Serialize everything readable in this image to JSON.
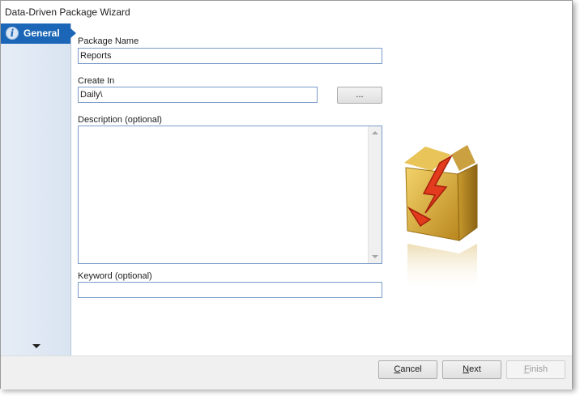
{
  "window": {
    "title": "Data-Driven Package Wizard"
  },
  "sidebar": {
    "items": [
      {
        "label": "General",
        "icon": "info-icon",
        "selected": true
      }
    ],
    "scroll_icon": "chevron-down-icon"
  },
  "form": {
    "package_name": {
      "label": "Package Name",
      "value": "Reports"
    },
    "create_in": {
      "label": "Create In",
      "value": "Daily\\",
      "browse_label": "..."
    },
    "description": {
      "label": "Description (optional)",
      "value": ""
    },
    "keyword": {
      "label": "Keyword (optional)",
      "value": ""
    }
  },
  "illustration": {
    "icon": "package-box-icon"
  },
  "footer": {
    "cancel": {
      "accel": "C",
      "rest": "ancel"
    },
    "next": {
      "accel": "N",
      "rest": "ext"
    },
    "finish": {
      "accel": "F",
      "rest": "inish",
      "enabled": false
    }
  },
  "colors": {
    "accent": "#1b66b6",
    "sidebar_bg": "#dde6f2",
    "input_border": "#7a9cc8",
    "footer_bg": "#f0f0f0"
  }
}
